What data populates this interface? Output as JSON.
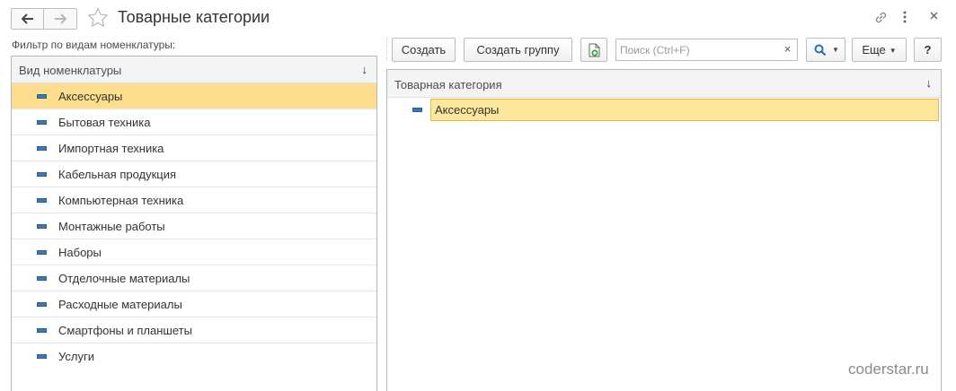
{
  "window": {
    "title": "Товарные категории"
  },
  "left_panel": {
    "filter_label": "Фильтр по видам номенклатуры:",
    "column_header": "Вид номенклатуры",
    "sort_indicator": "↓",
    "items": [
      {
        "label": "Аксессуары",
        "selected": true
      },
      {
        "label": "Бытовая техника",
        "selected": false
      },
      {
        "label": "Импортная техника",
        "selected": false
      },
      {
        "label": "Кабельная продукция",
        "selected": false
      },
      {
        "label": "Компьютерная техника",
        "selected": false
      },
      {
        "label": "Монтажные работы",
        "selected": false
      },
      {
        "label": "Наборы",
        "selected": false
      },
      {
        "label": "Отделочные материалы",
        "selected": false
      },
      {
        "label": "Расходные материалы",
        "selected": false
      },
      {
        "label": "Смартфоны и планшеты",
        "selected": false
      },
      {
        "label": "Услуги",
        "selected": false
      }
    ]
  },
  "toolbar": {
    "create_label": "Создать",
    "create_group_label": "Создать группу",
    "search_placeholder": "Поиск (Ctrl+F)",
    "search_clear": "×",
    "more_label": "Еще",
    "help_label": "?"
  },
  "right_panel": {
    "column_header": "Товарная категория",
    "sort_indicator": "↓",
    "items": [
      {
        "label": "Аксессуары",
        "selected": true
      }
    ]
  },
  "watermark": "coderstar.ru",
  "colors": {
    "selection": "#fcde8c",
    "selection_border": "#e8b93c",
    "item_icon": "#3b79b5"
  },
  "icons": [
    "back-arrow-icon",
    "forward-arrow-icon",
    "favorite-star-icon",
    "link-icon",
    "more-vertical-icon",
    "close-icon",
    "copy-icon",
    "search-icon",
    "sort-down-icon",
    "list-item-icon"
  ]
}
